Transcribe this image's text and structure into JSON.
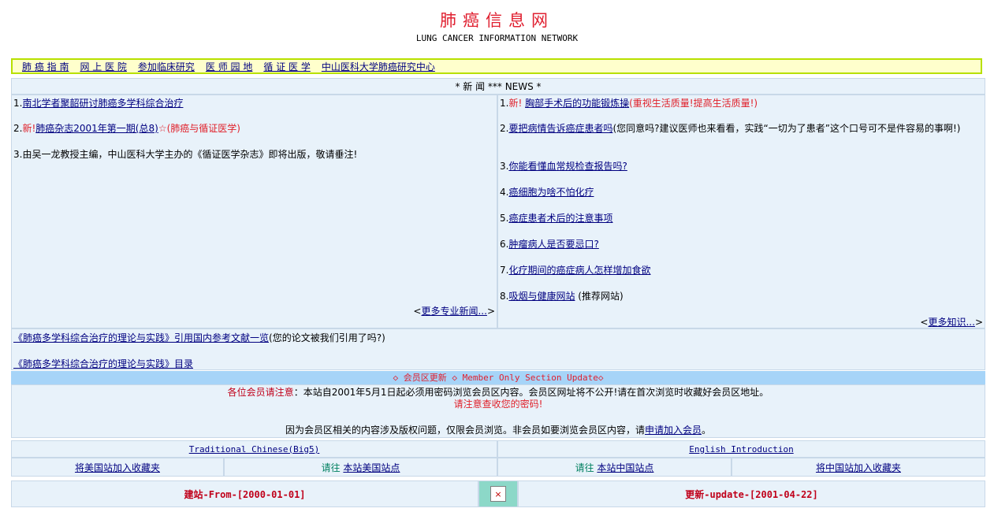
{
  "header": {
    "title": "肺癌信息网",
    "subtitle": "LUNG CANCER INFORMATION NETWORK"
  },
  "nav": [
    "肺 癌 指 南",
    "网 上 医 院",
    "参加临床研究",
    "医 师 园 地",
    "循 证 医 学",
    "中山医科大学肺癌研究中心"
  ],
  "news_bar": "* 新 闻 *** NEWS *",
  "left_news": {
    "item1_no": "1.",
    "item1_link": "南北学者聚韶研讨肺癌多学科综合治疗",
    "item2_no": "2.",
    "item2_new": "新!",
    "item2_link": "肺癌杂志2001年第一期(总8)",
    "item2_star": "☆",
    "item2_note": "(肺癌与循证医学)",
    "item3": "3.由吴一龙教授主编，中山医科大学主办的《循证医学杂志》即将出版，敬请垂注!",
    "more_open": "<",
    "more": "更多专业新闻...",
    "more_close": ">"
  },
  "right_news": {
    "item1_no": "1.",
    "item1_new": "新!",
    "item1_link": "胸部手术后的功能锻炼操",
    "item1_note": "(重视生活质量!提高生活质量!)",
    "item2_no": "2.",
    "item2_link": "要把病情告诉癌症患者吗",
    "item2_note": "(您同意吗?建议医师也来看看，实践“一切为了患者”这个口号可不是件容易的事啊!)",
    "item3_no": "3.",
    "item3_link": "你能看懂血常规检查报告吗?",
    "item4_no": "4.",
    "item4_link": "癌细胞为啥不怕化疗",
    "item5_no": "5.",
    "item5_link": "癌症患者术后的注意事项",
    "item6_no": "6.",
    "item6_link": "肿瘤病人是否要忌口?",
    "item7_no": "7.",
    "item7_link": "化疗期间的癌症病人怎样增加食欲",
    "item8_no": "8.",
    "item8_link": "吸烟与健康网站",
    "item8_note": "(推荐网站)",
    "more_open": "<",
    "more": "更多知识...",
    "more_close": ">"
  },
  "refs": {
    "line1_link": "《肺癌多学科综合治疗的理论与实践》引用国内参考文献一览",
    "line1_note": "(您的论文被我们引用了吗?)",
    "line2_link": "《肺癌多学科综合治疗的理论与实践》目录"
  },
  "member": {
    "bar": "◇ 会员区更新 ◇ Member Only Section Update◇",
    "notice_label": "各位会员请注意",
    "notice_text": "：本站自2001年5月1日起必须用密码浏览会员区内容。会员区网址将不公开!请在首次浏览时收藏好会员区地址。",
    "password_note": "请注意查收您的密码!",
    "copyright_text": "因为会员区相关的内容涉及版权问题，仅限会员浏览。非会员如要浏览会员区内容，请",
    "join_link": "申请加入会员",
    "period": "。"
  },
  "links": {
    "big5": "Traditional Chinese(Big5)",
    "english": "English Introduction",
    "fav_us": "将美国站加入收藏夹",
    "goto_label": "请往",
    "us_site": "本站美国站点",
    "goto_label2": "请往",
    "cn_site": "本站中国站点",
    "fav_cn": "将中国站加入收藏夹"
  },
  "footer": {
    "from": "建站-From-[2000-01-01]",
    "counter": "×",
    "update": "更新-update-[2001-04-22]"
  },
  "colors": {
    "title_red": "#e02030",
    "panel_bg": "#e8f2fa",
    "member_bar": "#a6d4f8",
    "nav_bg": "#ffffcc",
    "nav_border": "#b8e000",
    "link": "#000080"
  }
}
